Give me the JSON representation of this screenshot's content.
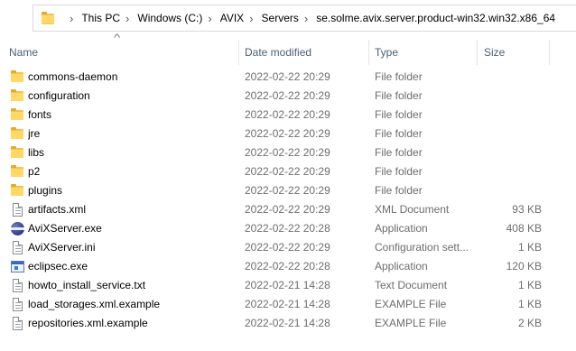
{
  "address_bar": {
    "breadcrumbs": [
      "This PC",
      "Windows (C:)",
      "AVIX",
      "Servers",
      "se.solme.avix.server.product-win32.win32.x86_64"
    ]
  },
  "columns": {
    "name": "Name",
    "date": "Date modified",
    "type": "Type",
    "size": "Size"
  },
  "rows": [
    {
      "name": "commons-daemon",
      "date": "2022-02-22 20:29",
      "type": "File folder",
      "size": "",
      "icon": "folder-icon"
    },
    {
      "name": "configuration",
      "date": "2022-02-22 20:29",
      "type": "File folder",
      "size": "",
      "icon": "folder-icon"
    },
    {
      "name": "fonts",
      "date": "2022-02-22 20:29",
      "type": "File folder",
      "size": "",
      "icon": "folder-icon"
    },
    {
      "name": "jre",
      "date": "2022-02-22 20:29",
      "type": "File folder",
      "size": "",
      "icon": "folder-icon"
    },
    {
      "name": "libs",
      "date": "2022-02-22 20:29",
      "type": "File folder",
      "size": "",
      "icon": "folder-icon"
    },
    {
      "name": "p2",
      "date": "2022-02-22 20:29",
      "type": "File folder",
      "size": "",
      "icon": "folder-icon"
    },
    {
      "name": "plugins",
      "date": "2022-02-22 20:29",
      "type": "File folder",
      "size": "",
      "icon": "folder-icon"
    },
    {
      "name": "artifacts.xml",
      "date": "2022-02-22 20:29",
      "type": "XML Document",
      "size": "93 KB",
      "icon": "document-icon"
    },
    {
      "name": "AviXServer.exe",
      "date": "2022-02-22 20:28",
      "type": "Application",
      "size": "408 KB",
      "icon": "eclipse-app-icon"
    },
    {
      "name": "AviXServer.ini",
      "date": "2022-02-22 20:29",
      "type": "Configuration sett...",
      "size": "1 KB",
      "icon": "document-icon"
    },
    {
      "name": "eclipsec.exe",
      "date": "2022-02-22 20:28",
      "type": "Application",
      "size": "120 KB",
      "icon": "console-app-icon"
    },
    {
      "name": "howto_install_service.txt",
      "date": "2022-02-21 14:28",
      "type": "Text Document",
      "size": "1 KB",
      "icon": "document-icon"
    },
    {
      "name": "load_storages.xml.example",
      "date": "2022-02-21 14:28",
      "type": "EXAMPLE File",
      "size": "1 KB",
      "icon": "document-icon"
    },
    {
      "name": "repositories.xml.example",
      "date": "2022-02-21 14:28",
      "type": "EXAMPLE File",
      "size": "2 KB",
      "icon": "document-icon"
    }
  ]
}
